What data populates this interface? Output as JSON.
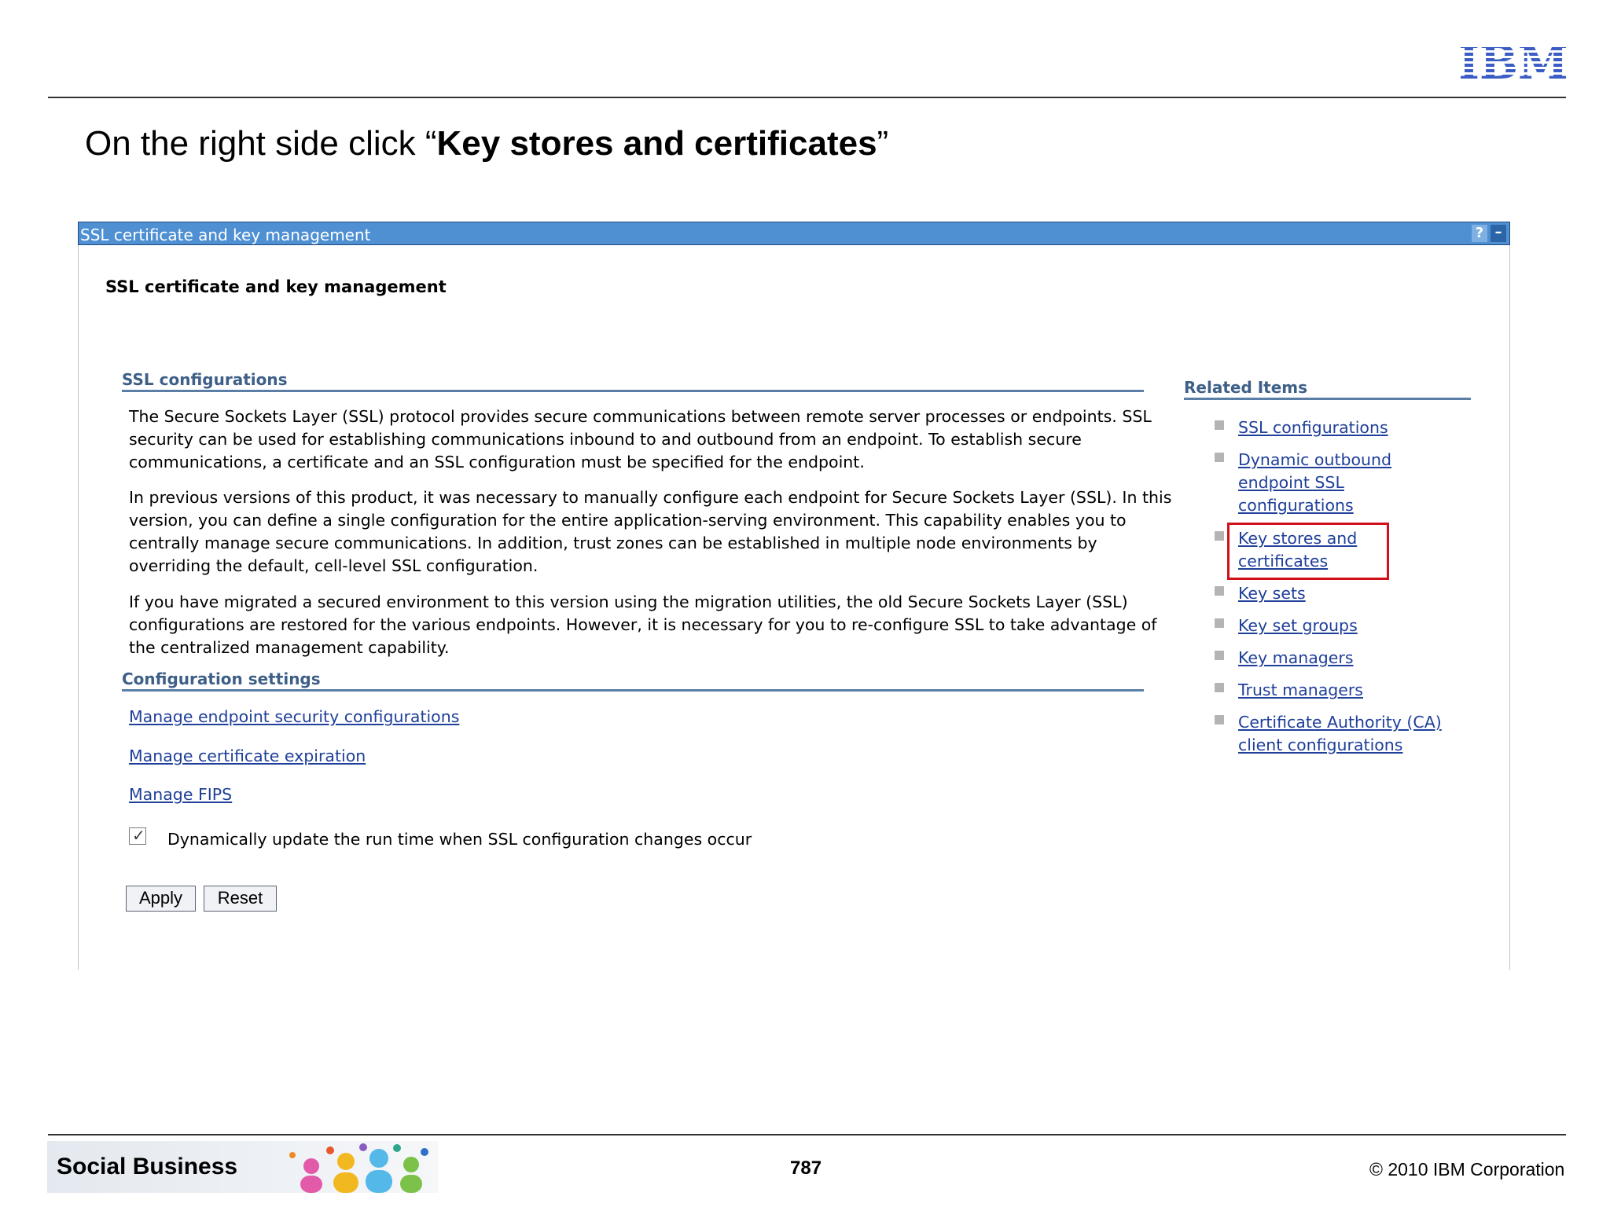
{
  "brand": {
    "logo_text": "IBM"
  },
  "slide": {
    "title_prefix": "On the right side click “",
    "title_bold": "Key stores and certificates",
    "title_suffix": "”"
  },
  "panel": {
    "titlebar": "SSL certificate and key management",
    "help_glyph": "?",
    "minimize_glyph": "–",
    "page_heading": "SSL certificate and key management"
  },
  "ssl_section": {
    "heading": "SSL configurations",
    "paragraphs": [
      "The Secure Sockets Layer (SSL) protocol provides secure communications between remote server processes or endpoints. SSL security can be used for establishing communications inbound to and outbound from an endpoint. To establish secure communications, a certificate and an SSL configuration must be specified for the endpoint.",
      "In previous versions of this product, it was necessary to manually configure each endpoint for Secure Sockets Layer (SSL). In this version, you can define a single configuration for the entire application-serving environment. This capability enables you to centrally manage secure communications. In addition, trust zones can be established in multiple node environments by overriding the default, cell-level SSL configuration.",
      "If you have migrated a secured environment to this version using the migration utilities, the old Secure Sockets Layer (SSL) configurations are restored for the various endpoints. However, it is necessary for you to re-configure SSL to take advantage of the centralized management capability."
    ]
  },
  "config_section": {
    "heading": "Configuration settings",
    "links": [
      "Manage endpoint security configurations",
      "Manage certificate expiration",
      "Manage FIPS"
    ],
    "checkbox_label": "Dynamically update the run time when SSL configuration changes occur",
    "checkbox_checked": true,
    "apply_label": "Apply",
    "reset_label": "Reset"
  },
  "related": {
    "heading": "Related Items",
    "items": [
      [
        "SSL configurations"
      ],
      [
        "Dynamic outbound",
        "endpoint SSL",
        "configurations"
      ],
      [
        "Key stores and",
        "certificates"
      ],
      [
        "Key sets"
      ],
      [
        "Key set groups"
      ],
      [
        "Key managers"
      ],
      [
        "Trust managers"
      ],
      [
        "Certificate Authority (CA)",
        "client configurations"
      ]
    ],
    "highlighted_index": 2,
    "highlight_color": "#d0101b"
  },
  "footer": {
    "banner_text": "Social Business",
    "page_number": "787",
    "copyright": "© 2010 IBM Corporation"
  },
  "colors": {
    "titlebar": "#4f90d3",
    "section_heading": "#3e5f87",
    "link": "#1f3f9a",
    "ibm_blue": "#3a5cc4"
  }
}
